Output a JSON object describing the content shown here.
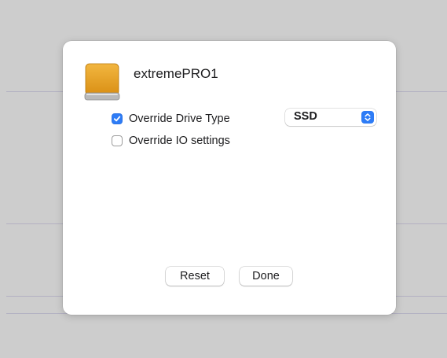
{
  "drive": {
    "name": "extremePRO1",
    "icon": "external-drive-icon",
    "icon_color": "#e8a020"
  },
  "options": {
    "override_drive_type": {
      "label": "Override Drive Type",
      "checked": true
    },
    "override_io_settings": {
      "label": "Override IO settings",
      "checked": false
    }
  },
  "drive_type_select": {
    "value": "SSD",
    "icon": "up-down-chevron-icon"
  },
  "buttons": {
    "reset_label": "Reset",
    "done_label": "Done"
  },
  "colors": {
    "accent": "#2e7cf6",
    "dialog_background": "#ffffff",
    "backdrop": "#cdcdcd"
  }
}
